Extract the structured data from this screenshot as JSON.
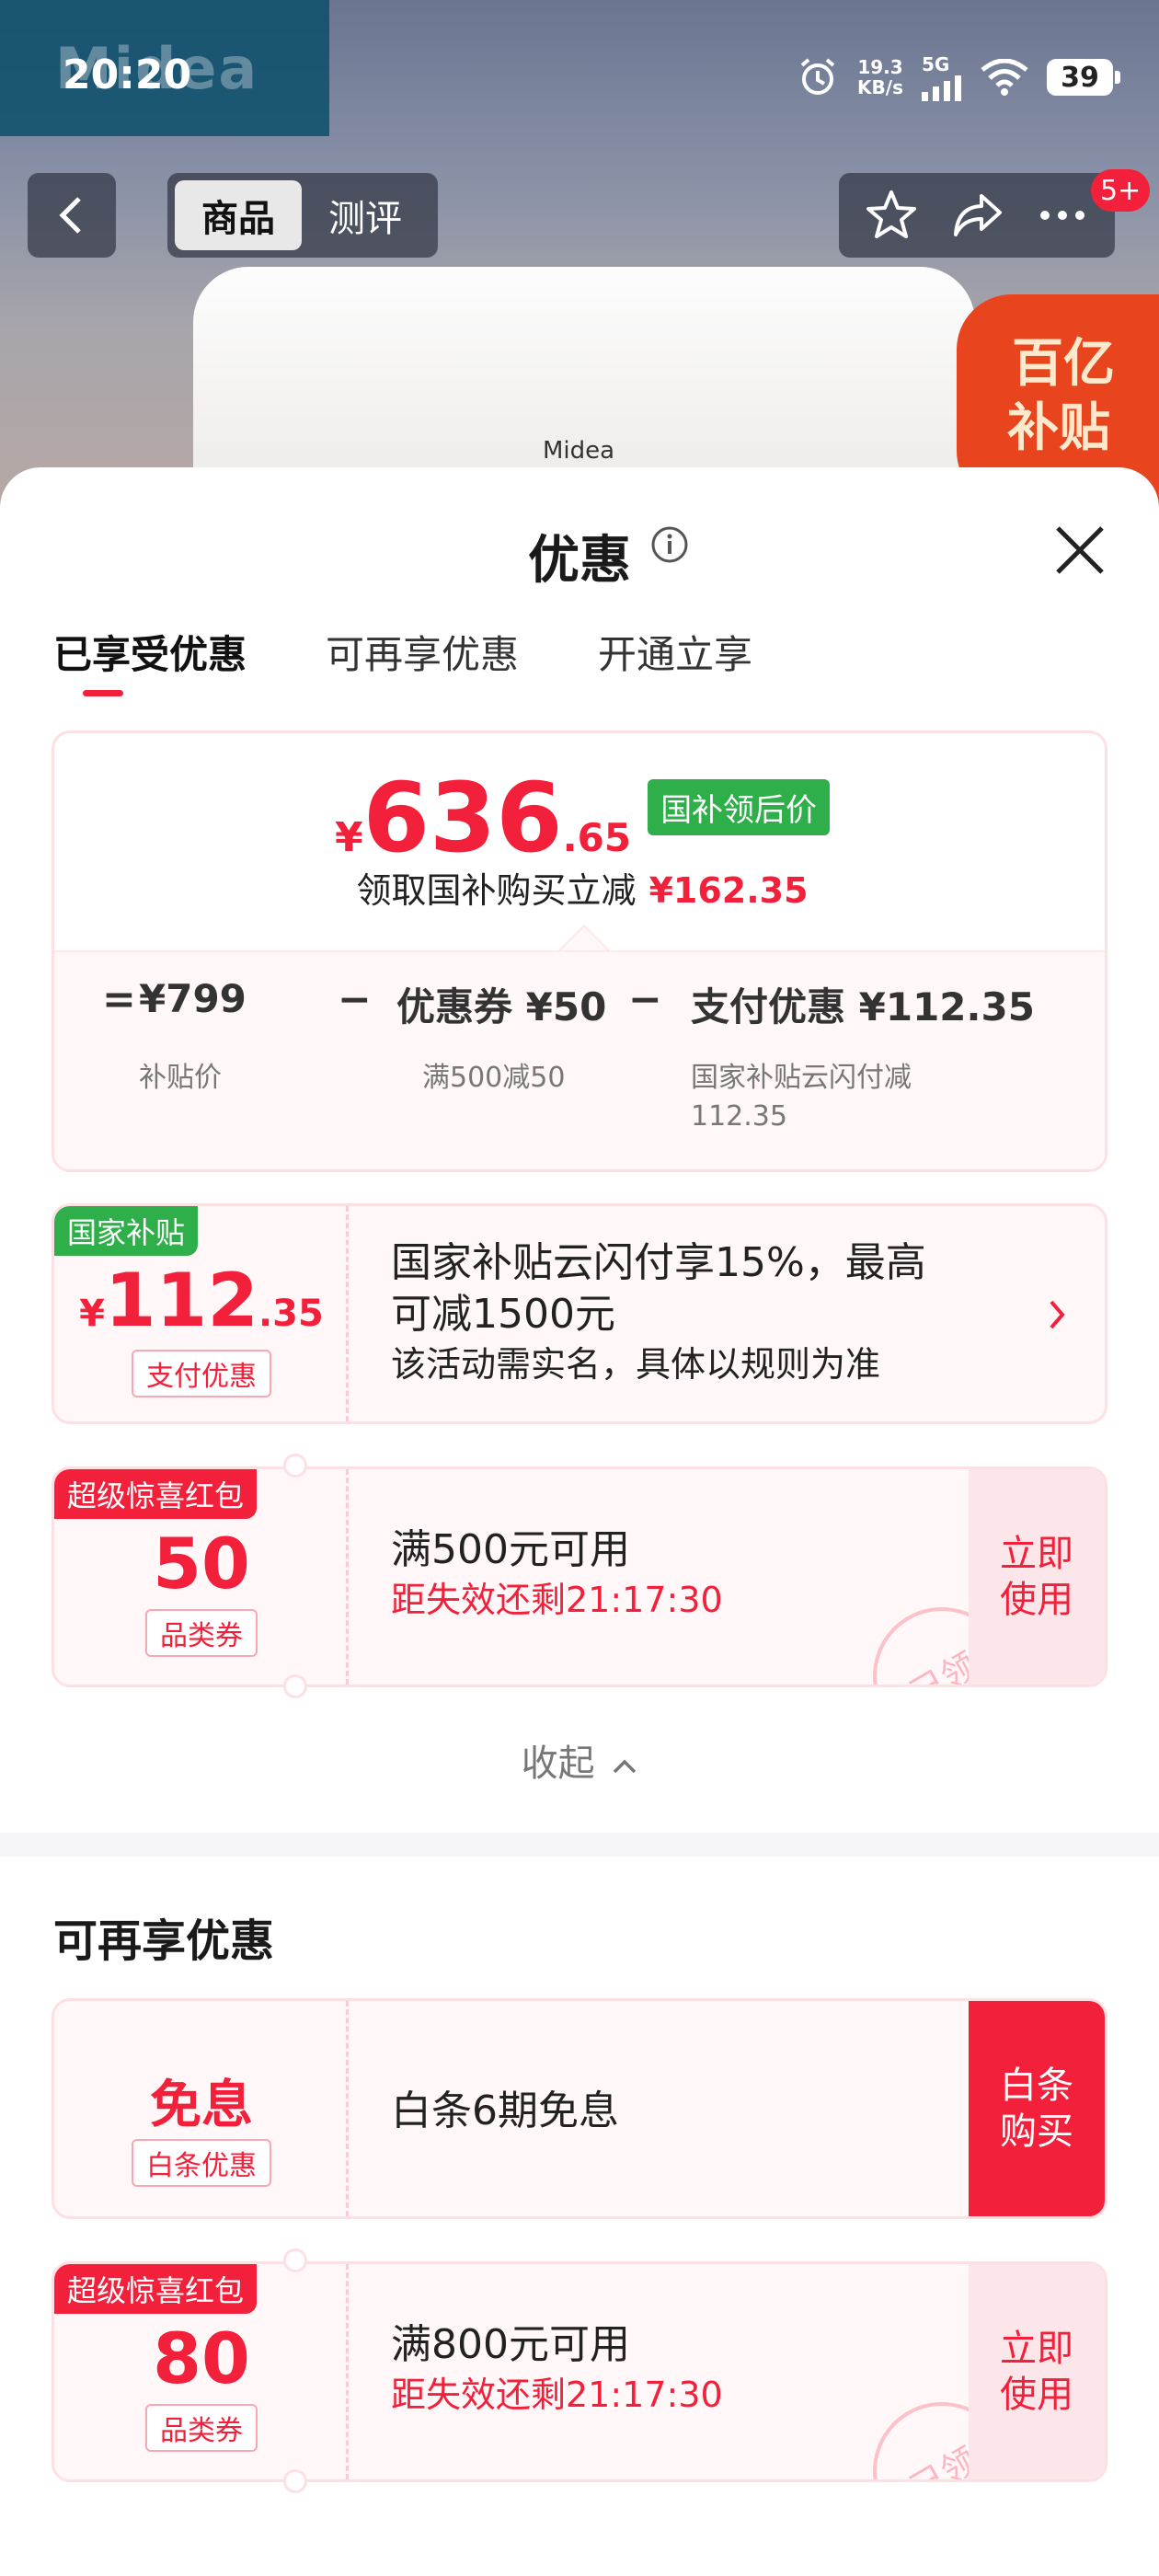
{
  "status_bar": {
    "time": "20:20",
    "net_speed_value": "19.3",
    "net_speed_unit": "KB/s",
    "signal_label": "5G",
    "battery": "39"
  },
  "background": {
    "brand_text": "Midea",
    "product_logo": "Midea",
    "promo_line1": "百亿",
    "promo_line2": "补贴"
  },
  "nav": {
    "tabs": [
      "商品",
      "测评"
    ],
    "badge": "5+"
  },
  "sheet": {
    "title": "优惠",
    "tabs": [
      "已享受优惠",
      "可再享优惠",
      "开通立享"
    ]
  },
  "summary": {
    "price_symbol": "¥",
    "price_int": "636",
    "price_dec": ".65",
    "price_tag": "国补领后价",
    "subtitle": "领取国补购买立减",
    "subtitle_amount": "¥162.35",
    "calc": {
      "eq": "=",
      "minus": "−",
      "subsidy_value": "¥799",
      "subsidy_label": "补贴价",
      "coupon_value": "优惠券 ¥50",
      "coupon_label": "满500减50",
      "pay_value": "支付优惠 ¥112.35",
      "pay_label": "国家补贴云闪付减",
      "pay_label_2": "112.35"
    }
  },
  "enjoyed": [
    {
      "tag": "国家补贴",
      "symbol": "¥",
      "amount_int": "112",
      "amount_dec": ".35",
      "kind": "支付优惠",
      "title_line1": "国家补贴云闪付享15%，最高",
      "title_line2": "可减1500元",
      "sub": "该活动需实名，具体以规则为准"
    },
    {
      "tag": "超级惊喜红包",
      "amount": "50",
      "kind": "品类券",
      "title": "满500元可用",
      "expire": "距失效还剩21:17:30",
      "action": "立即使用",
      "stamp": "已领"
    }
  ],
  "collapse_label": "收起",
  "more_section": {
    "title": "可再享优惠",
    "items": [
      {
        "amount": "免息",
        "kind": "白条优惠",
        "title": "白条6期免息",
        "action": "白条购买"
      },
      {
        "tag": "超级惊喜红包",
        "amount": "80",
        "kind": "品类券",
        "title": "满800元可用",
        "expire": "距失效还剩21:17:30",
        "action": "立即使用",
        "stamp": "已领"
      }
    ]
  },
  "colors": {
    "accent_red": "#f2203a",
    "subsidy_green": "#2eaf4a",
    "card_tint": "#fff7f8"
  }
}
